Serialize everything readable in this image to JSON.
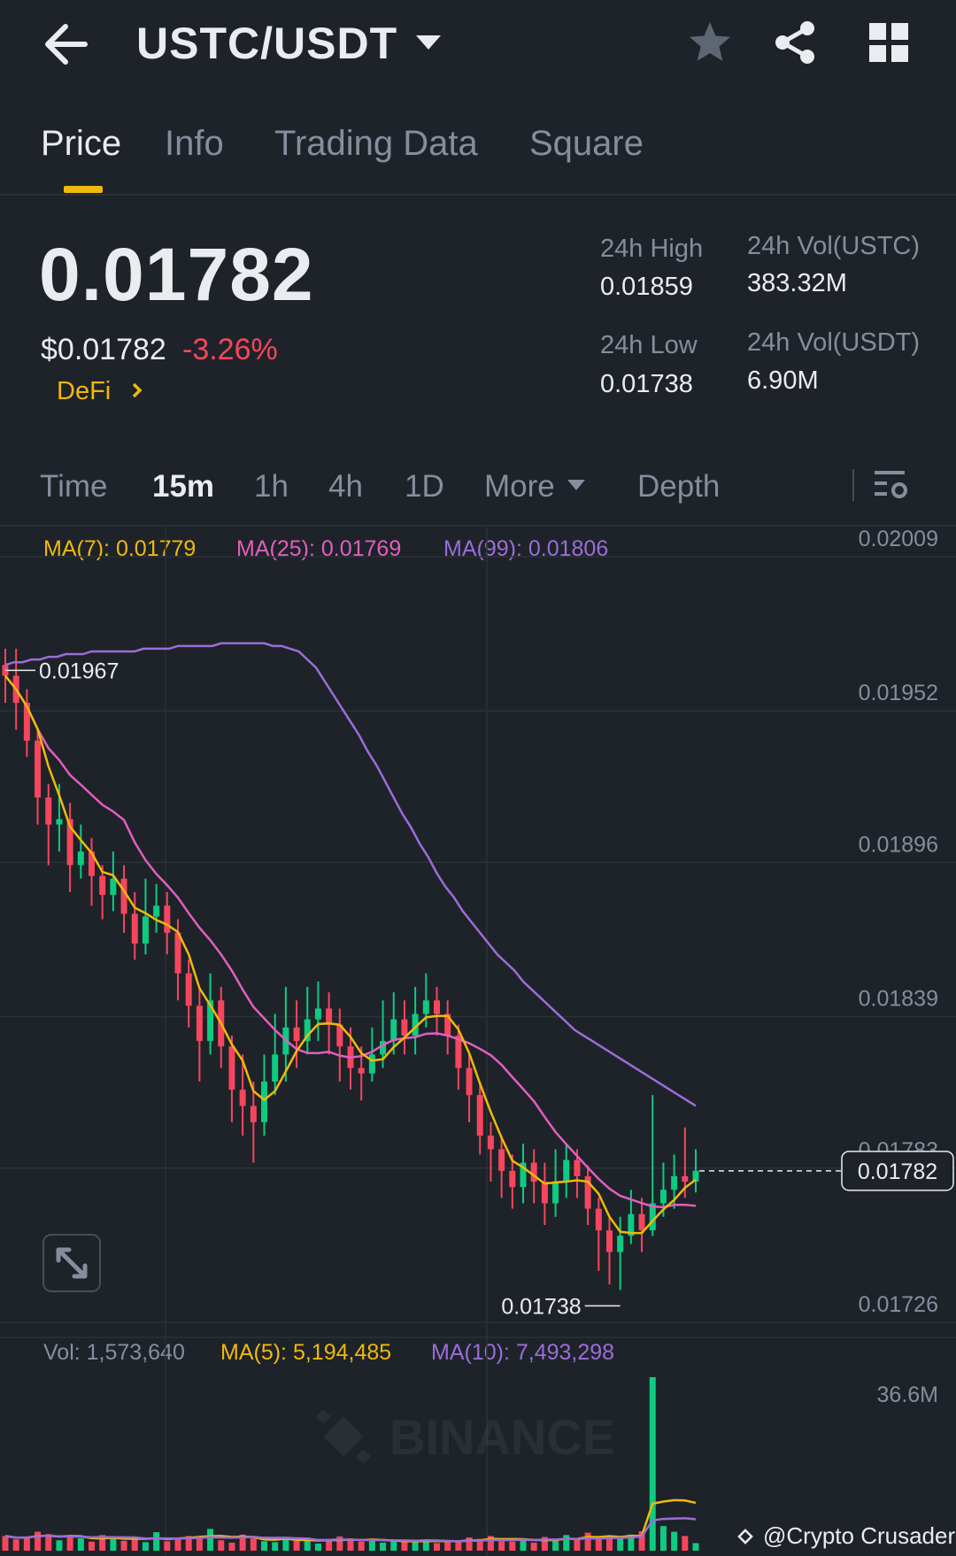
{
  "header": {
    "pair": "USTC/USDT",
    "icons": [
      "back-arrow-icon",
      "chevron-down-icon",
      "star-icon",
      "share-icon",
      "grid-icon"
    ]
  },
  "tabs": [
    {
      "label": "Price",
      "active": true
    },
    {
      "label": "Info",
      "active": false
    },
    {
      "label": "Trading Data",
      "active": false
    },
    {
      "label": "Square",
      "active": false
    }
  ],
  "ticker": {
    "last_price": "0.01782",
    "usd_price": "$0.01782",
    "change_pct": "-3.26%",
    "sector": "DeFi",
    "high_label": "24h High",
    "high_value": "0.01859",
    "low_label": "24h Low",
    "low_value": "0.01738",
    "vol_base_label": "24h Vol(USTC)",
    "vol_base_value": "383.32M",
    "vol_quote_label": "24h Vol(USDT)",
    "vol_quote_value": "6.90M"
  },
  "intervals": {
    "items": [
      "Time",
      "15m",
      "1h",
      "4h",
      "1D"
    ],
    "active": "15m",
    "more": "More",
    "depth": "Depth"
  },
  "ma_legend": {
    "ma7": "MA(7): 0.01779",
    "ma25": "MA(25): 0.01769",
    "ma99": "MA(99): 0.01806"
  },
  "vol_legend": {
    "vol": "Vol: 1,573,640",
    "ma5": "MA(5): 5,194,485",
    "ma10": "MA(10): 7,493,298"
  },
  "watermark": "BINANCE",
  "credit": "@Crypto Crusader",
  "colors": {
    "up": "#0ecb81",
    "down": "#f6465d",
    "ma7": "#f0b90b",
    "ma25": "#e25ebf",
    "ma99": "#9b6dd8",
    "accent": "#f0b90b"
  },
  "chart_data": {
    "type": "candlestick",
    "price_axis": {
      "ticks": [
        "0.02009",
        "0.01952",
        "0.01896",
        "0.01839",
        "0.01783",
        "0.01726"
      ],
      "range": [
        0.01726,
        0.02009
      ]
    },
    "current_price_label": "0.01782",
    "current_price": 0.01782,
    "high_marker": {
      "label": "0.01967",
      "value": 0.01967
    },
    "low_marker": {
      "label": "0.01738",
      "value": 0.01738
    },
    "volume_axis": {
      "max_label": "36.6M",
      "max": 36600000
    },
    "ma99": [
      0.01969,
      0.0197,
      0.0197,
      0.01971,
      0.01971,
      0.01972,
      0.01972,
      0.01973,
      0.01973,
      0.01973,
      0.01974,
      0.01974,
      0.01974,
      0.01974,
      0.01974,
      0.01974,
      0.01975,
      0.01975,
      0.01975,
      0.01975,
      0.01976,
      0.01976,
      0.01976,
      0.01976,
      0.01976,
      0.01977,
      0.01977,
      0.01977,
      0.01977,
      0.01977,
      0.01977,
      0.01976,
      0.01976,
      0.01975,
      0.01974,
      0.01971,
      0.01968,
      0.01963,
      0.01958,
      0.01953,
      0.01948,
      0.01943,
      0.01937,
      0.01932,
      0.01926,
      0.0192,
      0.01914,
      0.01909,
      0.01903,
      0.01898,
      0.01892,
      0.01887,
      0.01883,
      0.01878,
      0.01874,
      0.0187,
      0.01866,
      0.01862,
      0.01859,
      0.01856,
      0.01852,
      0.01849,
      0.01846,
      0.01843,
      0.0184,
      0.01837,
      0.01834,
      0.01832,
      0.0183,
      0.01828,
      0.01826,
      0.01824,
      0.01822,
      0.0182,
      0.01818,
      0.01816,
      0.01814,
      0.01812,
      0.0181,
      0.01808,
      0.01806
    ],
    "candles": [
      [
        0.01969,
        0.01965,
        0.01975,
        0.01955
      ],
      [
        0.01965,
        0.01955,
        0.01975,
        0.01945
      ],
      [
        0.01955,
        0.01941,
        0.0196,
        0.01935
      ],
      [
        0.01941,
        0.0192,
        0.01945,
        0.0191
      ],
      [
        0.0192,
        0.0191,
        0.01925,
        0.01895
      ],
      [
        0.0191,
        0.01912,
        0.01925,
        0.019
      ],
      [
        0.01912,
        0.01895,
        0.01918,
        0.01885
      ],
      [
        0.01895,
        0.019,
        0.0191,
        0.0189
      ],
      [
        0.019,
        0.01891,
        0.01905,
        0.0188
      ],
      [
        0.01891,
        0.01884,
        0.01895,
        0.01875
      ],
      [
        0.01884,
        0.0189,
        0.019,
        0.01878
      ],
      [
        0.0189,
        0.01877,
        0.01895,
        0.0187
      ],
      [
        0.01877,
        0.01866,
        0.01885,
        0.0186
      ],
      [
        0.01866,
        0.01876,
        0.0189,
        0.01862
      ],
      [
        0.01876,
        0.0188,
        0.01888,
        0.0187
      ],
      [
        0.0188,
        0.0187,
        0.01885,
        0.01862
      ],
      [
        0.0187,
        0.01855,
        0.01875,
        0.01845
      ],
      [
        0.01855,
        0.01843,
        0.0186,
        0.01835
      ],
      [
        0.01843,
        0.0183,
        0.0185,
        0.01815
      ],
      [
        0.0183,
        0.01845,
        0.01855,
        0.01825
      ],
      [
        0.01845,
        0.01828,
        0.0185,
        0.0182
      ],
      [
        0.01828,
        0.01812,
        0.01832,
        0.018
      ],
      [
        0.01812,
        0.01806,
        0.01825,
        0.01795
      ],
      [
        0.01806,
        0.018,
        0.01815,
        0.01785
      ],
      [
        0.018,
        0.01815,
        0.01825,
        0.01795
      ],
      [
        0.01815,
        0.01825,
        0.0184,
        0.0181
      ],
      [
        0.01825,
        0.01835,
        0.0185,
        0.01815
      ],
      [
        0.01835,
        0.0183,
        0.01845,
        0.0182
      ],
      [
        0.0183,
        0.01838,
        0.0185,
        0.01825
      ],
      [
        0.01838,
        0.01842,
        0.01852,
        0.0183
      ],
      [
        0.01842,
        0.01836,
        0.01848,
        0.01825
      ],
      [
        0.01836,
        0.01828,
        0.01842,
        0.01815
      ],
      [
        0.01828,
        0.0182,
        0.01835,
        0.01812
      ],
      [
        0.0182,
        0.01818,
        0.01828,
        0.01808
      ],
      [
        0.01818,
        0.01825,
        0.01835,
        0.01815
      ],
      [
        0.01825,
        0.0183,
        0.01845,
        0.0182
      ],
      [
        0.0183,
        0.01838,
        0.01848,
        0.01825
      ],
      [
        0.01838,
        0.01832,
        0.01845,
        0.01825
      ],
      [
        0.01832,
        0.0184,
        0.0185,
        0.01825
      ],
      [
        0.0184,
        0.01845,
        0.01855,
        0.01835
      ],
      [
        0.01845,
        0.0184,
        0.0185,
        0.01832
      ],
      [
        0.0184,
        0.01832,
        0.01845,
        0.01825
      ],
      [
        0.01832,
        0.0182,
        0.01836,
        0.01812
      ],
      [
        0.0182,
        0.0181,
        0.01825,
        0.018
      ],
      [
        0.0181,
        0.01795,
        0.01815,
        0.01788
      ],
      [
        0.01795,
        0.0179,
        0.018,
        0.01778
      ],
      [
        0.0179,
        0.01782,
        0.01795,
        0.01772
      ],
      [
        0.01782,
        0.01776,
        0.01788,
        0.01768
      ],
      [
        0.01776,
        0.01785,
        0.01792,
        0.0177
      ],
      [
        0.01785,
        0.01778,
        0.0179,
        0.0177
      ],
      [
        0.01778,
        0.0177,
        0.01785,
        0.01762
      ],
      [
        0.0177,
        0.01778,
        0.0179,
        0.01765
      ],
      [
        0.01778,
        0.01786,
        0.01792,
        0.01772
      ],
      [
        0.01786,
        0.0178,
        0.0179,
        0.01772
      ],
      [
        0.0178,
        0.01768,
        0.01784,
        0.01762
      ],
      [
        0.01768,
        0.0176,
        0.01772,
        0.01745
      ],
      [
        0.0176,
        0.01752,
        0.01765,
        0.0174
      ],
      [
        0.01752,
        0.01758,
        0.01765,
        0.01738
      ],
      [
        0.01758,
        0.01766,
        0.01775,
        0.01755
      ],
      [
        0.01766,
        0.0176,
        0.01772,
        0.01752
      ],
      [
        0.0176,
        0.0177,
        0.0181,
        0.01758
      ],
      [
        0.0177,
        0.01775,
        0.01785,
        0.01765
      ],
      [
        0.01775,
        0.0178,
        0.01788,
        0.01768
      ],
      [
        0.0178,
        0.01778,
        0.01798,
        0.01772
      ],
      [
        0.01778,
        0.01782,
        0.0179,
        0.01774
      ]
    ],
    "volumes": [
      3.1,
      2.4,
      2.8,
      4.0,
      3.5,
      2.2,
      3.0,
      2.6,
      1.9,
      3.3,
      2.8,
      2.1,
      2.5,
      1.8,
      3.9,
      2.0,
      2.7,
      3.1,
      2.9,
      4.6,
      2.2,
      1.7,
      3.4,
      2.6,
      2.0,
      1.8,
      2.9,
      2.1,
      2.4,
      1.5,
      2.2,
      3.0,
      2.6,
      1.9,
      2.1,
      1.7,
      2.3,
      2.0,
      1.8,
      2.4,
      1.6,
      2.2,
      1.9,
      2.8,
      2.5,
      3.1,
      2.0,
      1.9,
      2.6,
      1.7,
      2.9,
      2.1,
      3.3,
      2.4,
      3.8,
      2.8,
      3.0,
      2.5,
      3.4,
      4.1,
      36.6,
      5.2,
      4.0,
      3.1,
      1.6
    ]
  }
}
